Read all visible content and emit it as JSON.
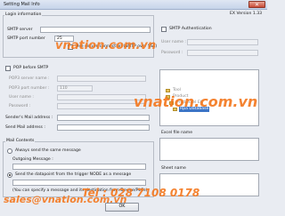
{
  "window": {
    "title": "Setting Mail Info",
    "version": "EX Version 1.33",
    "close_glyph": "✕"
  },
  "login": {
    "group_title": "Login information",
    "smtp_server_label": "SMTP server",
    "smtp_port_label": "SMTP port number",
    "smtp_port_value": "25",
    "secure_label": "Use secure connection (SMTP over SSL)"
  },
  "smtp_auth": {
    "label": "SMTP Authentication",
    "user_label": "User name :",
    "password_label": "Password :"
  },
  "pop": {
    "label": "POP before SMTP",
    "server_label": "POP3 server name :",
    "port_label": "POP3 port number :",
    "port_value": "110",
    "user_label": "User name :",
    "password_label": "Password :"
  },
  "sender_label": "Sender's Mail address :",
  "send_label": "Send Mail address :",
  "mail_contents": {
    "group_title": "Mail Contents",
    "option_same": "Always send the same message",
    "outgoing_label": "Outgoing Message :",
    "option_trigger": "Send the datapoint from the trigger NODE  as a message",
    "note": "(You can specify a message and its destination from Device/PLCs)"
  },
  "tree": {
    "items": [
      "Tool",
      "Product",
      "ProdExcel EC",
      "Rpa Database"
    ]
  },
  "excel_label": "Excel file name",
  "sheet_label": "Sheet name",
  "ok_label": "OK",
  "watermark": {
    "brand": "vnation.com.vn",
    "phone": "Tel : 028 7108 0178",
    "email": "sales@vnation.com.vn"
  },
  "colors": {
    "accent_orange": "#f47920",
    "tree_selected": "#3b74c6"
  }
}
